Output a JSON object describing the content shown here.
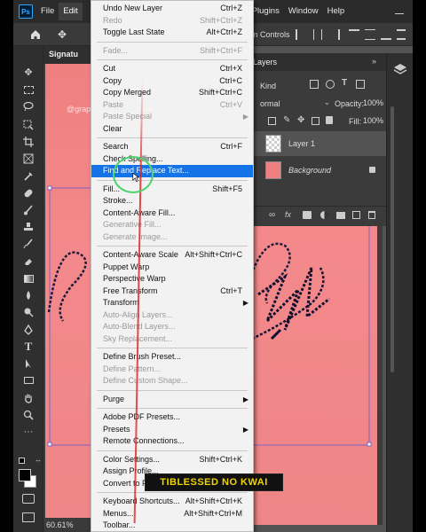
{
  "menubar": {
    "app_icon": "Ps",
    "items": [
      "File",
      "Edit",
      "Plugins",
      "Window",
      "Help"
    ],
    "active": "Edit"
  },
  "optbar": {
    "partial_label": "rm Controls"
  },
  "doc_tab": {
    "title": "Signatu"
  },
  "status": {
    "zoom": "60.61%"
  },
  "watermark": "@graph",
  "layers_panel": {
    "tab": "Layers",
    "filter_kind": "Kind",
    "blend_mode": "ormal",
    "opacity_label": "Opacity:",
    "opacity_value": "100%",
    "fill_label": "Fill:",
    "fill_value": "100%",
    "layers": [
      {
        "name": "Layer 1",
        "selected": true
      },
      {
        "name": "Background",
        "locked": true
      }
    ]
  },
  "edit_menu": {
    "items": [
      {
        "label": "Undo New Layer",
        "shortcut": "Ctrl+Z"
      },
      {
        "label": "Redo",
        "shortcut": "Shift+Ctrl+Z",
        "disabled": true
      },
      {
        "label": "Toggle Last State",
        "shortcut": "Alt+Ctrl+Z"
      },
      {
        "label": "Fade...",
        "shortcut": "Shift+Ctrl+F",
        "disabled": true
      },
      {
        "label": "Cut",
        "shortcut": "Ctrl+X"
      },
      {
        "label": "Copy",
        "shortcut": "Ctrl+C"
      },
      {
        "label": "Copy Merged",
        "shortcut": "Shift+Ctrl+C"
      },
      {
        "label": "Paste",
        "shortcut": "Ctrl+V",
        "disabled": true
      },
      {
        "label": "Paste Special",
        "shortcut": "",
        "disabled": true,
        "submenu": true
      },
      {
        "label": "Clear",
        "shortcut": ""
      },
      {
        "label": "Search",
        "shortcut": "Ctrl+F"
      },
      {
        "label": "Check Spelling...",
        "shortcut": ""
      },
      {
        "label": "Find and Replace Text...",
        "shortcut": "",
        "highlighted": true
      },
      {
        "label": "Fill...",
        "shortcut": "Shift+F5"
      },
      {
        "label": "Stroke...",
        "shortcut": ""
      },
      {
        "label": "Content-Aware Fill...",
        "shortcut": ""
      },
      {
        "label": "Generative Fill...",
        "shortcut": "",
        "disabled": true
      },
      {
        "label": "Generate Image...",
        "shortcut": "",
        "disabled": true
      },
      {
        "label": "Content-Aware Scale",
        "shortcut": "Alt+Shift+Ctrl+C"
      },
      {
        "label": "Puppet Warp",
        "shortcut": ""
      },
      {
        "label": "Perspective Warp",
        "shortcut": ""
      },
      {
        "label": "Free Transform",
        "shortcut": "Ctrl+T"
      },
      {
        "label": "Transform",
        "shortcut": "",
        "submenu": true
      },
      {
        "label": "Auto-Align Layers...",
        "shortcut": "",
        "disabled": true
      },
      {
        "label": "Auto-Blend Layers...",
        "shortcut": "",
        "disabled": true
      },
      {
        "label": "Sky Replacement...",
        "shortcut": "",
        "disabled": true
      },
      {
        "label": "Define Brush Preset...",
        "shortcut": ""
      },
      {
        "label": "Define Pattern...",
        "shortcut": "",
        "disabled": true
      },
      {
        "label": "Define Custom Shape...",
        "shortcut": "",
        "disabled": true
      },
      {
        "label": "Purge",
        "shortcut": "",
        "submenu": true
      },
      {
        "label": "Adobe PDF Presets...",
        "shortcut": ""
      },
      {
        "label": "Presets",
        "shortcut": "",
        "submenu": true
      },
      {
        "label": "Remote Connections...",
        "shortcut": ""
      },
      {
        "label": "Color Settings...",
        "shortcut": "Shift+Ctrl+K"
      },
      {
        "label": "Assign Profile...",
        "shortcut": ""
      },
      {
        "label": "Convert to P",
        "shortcut": ""
      },
      {
        "label": "Keyboard Shortcuts...",
        "shortcut": "Alt+Shift+Ctrl+K"
      },
      {
        "label": "Menus...",
        "shortcut": "Alt+Shift+Ctrl+M"
      },
      {
        "label": "Toolbar...",
        "shortcut": ""
      }
    ]
  },
  "caption": "TIBLESSED NO KWAI",
  "colors": {
    "menu_highlight": "#1473e6",
    "canvas_pink": "#f07f80",
    "caption_text": "#f0d400",
    "cursor_ring": "#4fd36f"
  }
}
